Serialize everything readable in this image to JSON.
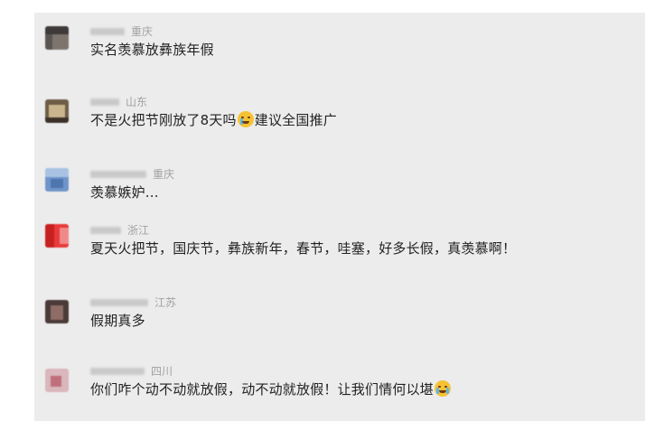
{
  "comments": [
    {
      "region": "重庆",
      "text": "实名羡慕放彝族年假"
    },
    {
      "region": "山东",
      "text_before": "不是火把节刚放了8天吗",
      "emoji": "crying-face-icon",
      "text_after": "建议全国推广"
    },
    {
      "region": "重庆",
      "text": "羡慕嫉妒..."
    },
    {
      "region": "浙江",
      "text": "夏天火把节，国庆节，彝族新年，春节，哇塞，好多长假，真羡慕啊！"
    },
    {
      "region": "江苏",
      "text": "假期真多"
    },
    {
      "region": "四川",
      "text": "你们咋个动不动就放假，动不动就放假！让我们情何以堪",
      "emoji": "loudly-crying-face-icon"
    }
  ],
  "colors": {
    "panel_bg": "#ececec",
    "text": "#222222",
    "region": "#a2a2a2"
  }
}
